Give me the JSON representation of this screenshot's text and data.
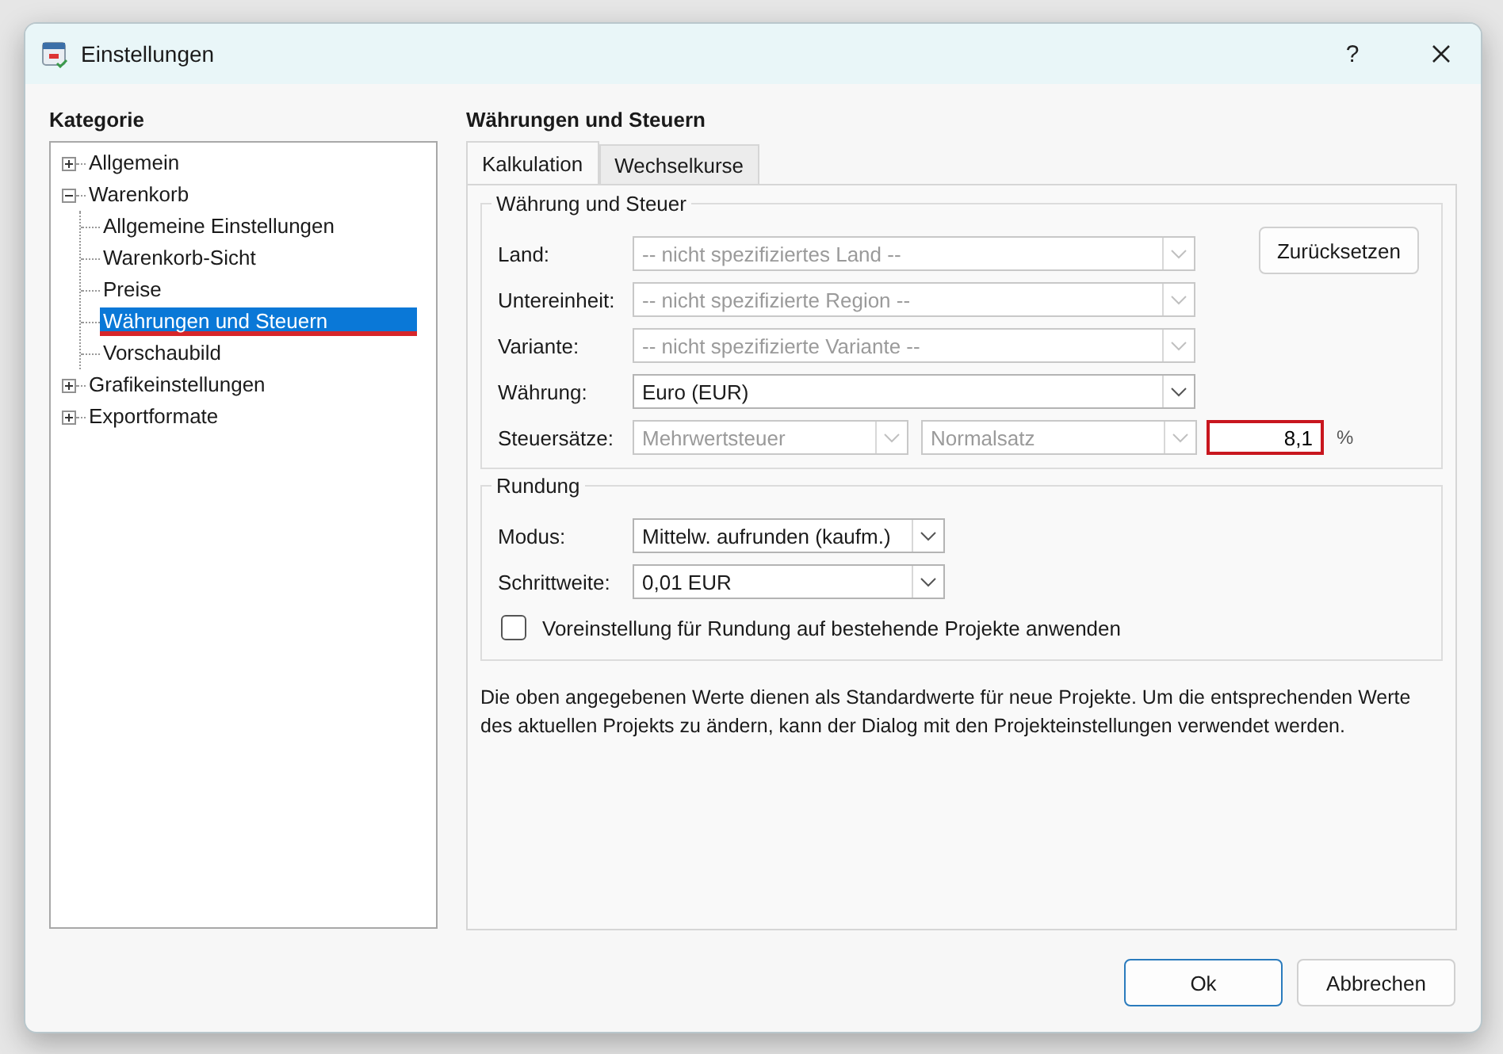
{
  "window": {
    "title": "Einstellungen",
    "help": "?"
  },
  "category": {
    "heading": "Kategorie",
    "tree": [
      {
        "label": "Allgemein",
        "expanded": false,
        "selected": false,
        "highlighted": false
      },
      {
        "label": "Warenkorb",
        "expanded": true,
        "selected": false,
        "highlighted": false,
        "children": [
          {
            "label": "Allgemeine Einstellungen",
            "selected": false,
            "highlighted": false
          },
          {
            "label": "Warenkorb-Sicht",
            "selected": false,
            "highlighted": false
          },
          {
            "label": "Preise",
            "selected": false,
            "highlighted": false
          },
          {
            "label": "Währungen und Steuern",
            "selected": true,
            "highlighted": true
          },
          {
            "label": "Vorschaubild",
            "selected": false,
            "highlighted": false
          }
        ]
      },
      {
        "label": "Grafikeinstellungen",
        "expanded": false,
        "selected": false,
        "highlighted": false
      },
      {
        "label": "Exportformate",
        "expanded": false,
        "selected": false,
        "highlighted": false
      }
    ]
  },
  "panel": {
    "title": "Währungen und Steuern",
    "tabs": [
      {
        "label": "Kalkulation",
        "selected": true
      },
      {
        "label": "Wechselkurse",
        "selected": false
      }
    ],
    "currency_group": {
      "legend": "Währung und Steuer",
      "reset_button": "Zurücksetzen",
      "rows": [
        {
          "kind": "combo",
          "label": "Land:",
          "value": "-- nicht spezifiziertes Land --",
          "disabled": true
        },
        {
          "kind": "combo",
          "label": "Untereinheit:",
          "value": "-- nicht spezifizierte Region --",
          "disabled": true
        },
        {
          "kind": "combo",
          "label": "Variante:",
          "value": "-- nicht spezifizierte Variante --",
          "disabled": true
        },
        {
          "kind": "combo",
          "label": "Währung:",
          "value": "Euro (EUR)",
          "disabled": false
        },
        {
          "kind": "tax",
          "label": "Steuersätze:",
          "combos": [
            {
              "value": "Mehrwertsteuer",
              "disabled": true
            },
            {
              "value": "Normalsatz",
              "disabled": true
            }
          ],
          "rate": {
            "value": "8,1",
            "highlighted": true
          },
          "unit": "%"
        }
      ]
    },
    "rounding_group": {
      "legend": "Rundung",
      "rows": [
        {
          "kind": "combo",
          "label": "Modus:",
          "value": "Mittelw. aufrunden (kaufm.)",
          "disabled": false
        },
        {
          "kind": "combo",
          "label": "Schrittweite:",
          "value": "0,01 EUR",
          "disabled": false
        }
      ],
      "checkbox": {
        "label": "Voreinstellung für Rundung auf bestehende Projekte anwenden",
        "checked": false
      }
    },
    "note": "Die oben angegebenen Werte dienen als Standardwerte für neue Projekte. Um die entsprechenden Werte des aktuellen Projekts zu ändern, kann der Dialog mit den Projekteinstellungen verwendet werden."
  },
  "buttons": [
    {
      "label": "Ok",
      "default": true
    },
    {
      "label": "Abbrechen",
      "default": false
    }
  ]
}
